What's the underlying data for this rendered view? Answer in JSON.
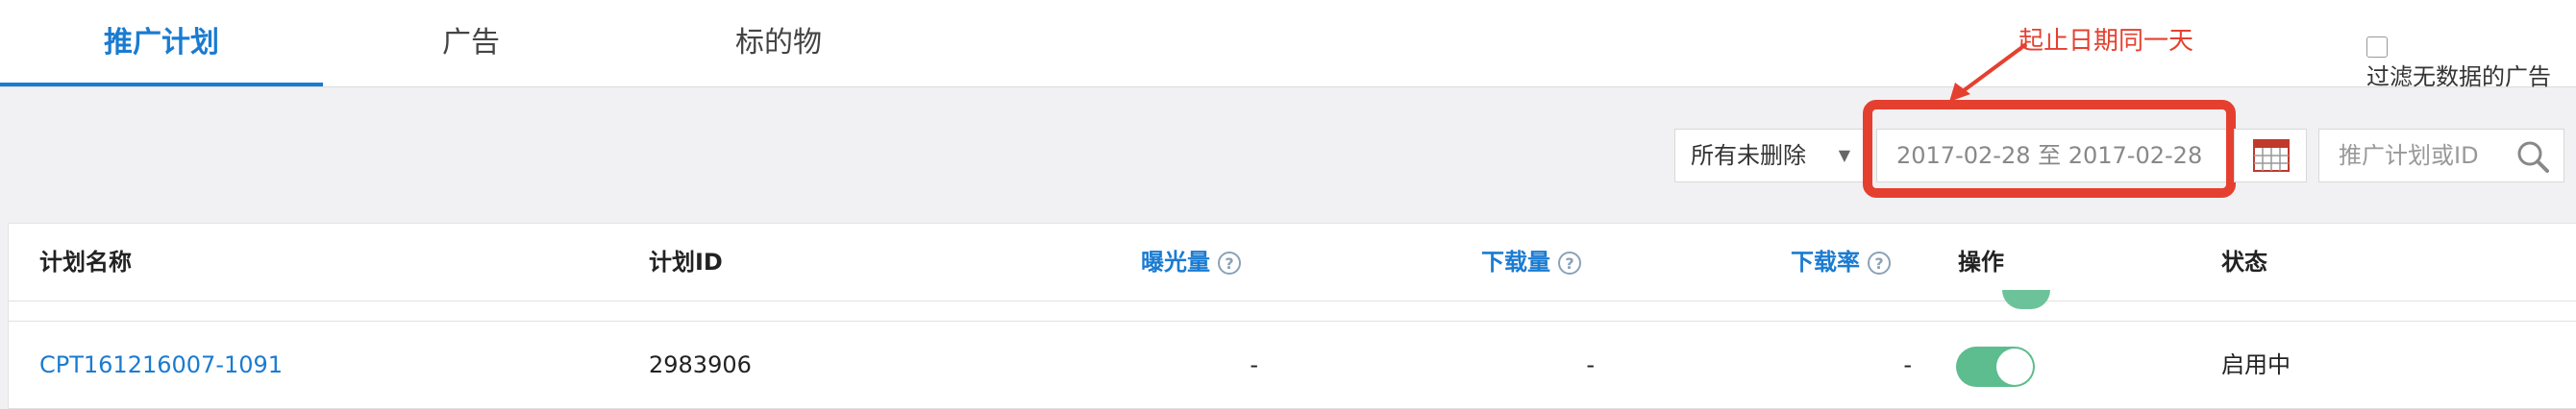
{
  "tabs": [
    {
      "label": "推广计划",
      "active": true
    },
    {
      "label": "广告",
      "active": false
    },
    {
      "label": "标的物",
      "active": false
    }
  ],
  "annotation": {
    "text": "起止日期同一天",
    "color": "#e5402f"
  },
  "filter": {
    "label": "过滤无数据的广告",
    "checked": false
  },
  "toolbar": {
    "status_select": "所有未删除",
    "date_range": "2017-02-28 至 2017-02-28",
    "search_placeholder": "推广计划或ID"
  },
  "table": {
    "columns": [
      {
        "label": "计划名称",
        "help": false
      },
      {
        "label": "计划ID",
        "help": false
      },
      {
        "label": "曝光量",
        "help": true
      },
      {
        "label": "下载量",
        "help": true
      },
      {
        "label": "下载率",
        "help": true
      },
      {
        "label": "操作",
        "help": false
      },
      {
        "label": "状态",
        "help": false
      }
    ],
    "rows": [
      {
        "name": "CPT161216007-1091",
        "id": "2983906",
        "impressions": "-",
        "downloads": "-",
        "download_rate": "-",
        "enabled": true,
        "status": "启用中"
      }
    ]
  },
  "colors": {
    "accent": "#1a7bd1",
    "toggle_on": "#5dbd8e",
    "highlight": "#e5402f"
  },
  "icons": [
    "calendar-icon",
    "search-icon",
    "chevron-down-icon",
    "help-icon"
  ]
}
